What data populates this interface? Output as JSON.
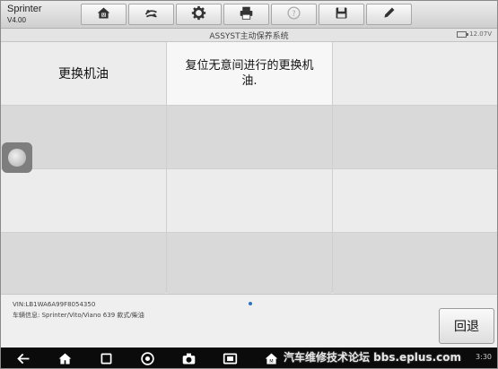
{
  "header": {
    "app_name": "Sprinter",
    "version": "V4.00",
    "toolbar": [
      {
        "icon": "home-icon",
        "name": "Home"
      },
      {
        "icon": "vehicle-swap-icon",
        "name": "Vehicle"
      },
      {
        "icon": "settings-gear-icon",
        "name": "Settings"
      },
      {
        "icon": "print-icon",
        "name": "Print"
      },
      {
        "icon": "help-icon",
        "name": "Help"
      },
      {
        "icon": "save-icon",
        "name": "Save"
      },
      {
        "icon": "edit-pen-icon",
        "name": "Edit"
      }
    ]
  },
  "strip": {
    "title": "ASSYST主动保养系统",
    "voltage": "12.07V"
  },
  "menu": {
    "items": [
      {
        "label": "更换机油"
      },
      {
        "label": "复位无意间进行的更换机油."
      }
    ]
  },
  "footer": {
    "vin": "VIN:LB1WA6A99F8054350",
    "vehicle_info": "车辆信息: Sprinter/Vito/Viano 639 款式/柴油",
    "back_label": "回退"
  },
  "navbar": {
    "watermark": "汽车维修技术论坛 bbs.eplus.com",
    "clock": "3:30"
  },
  "colors": {
    "toolbar_bg": "#dcdcdc",
    "nav_bg": "#0b0b0b",
    "page_indicator": "#2a74c9"
  }
}
